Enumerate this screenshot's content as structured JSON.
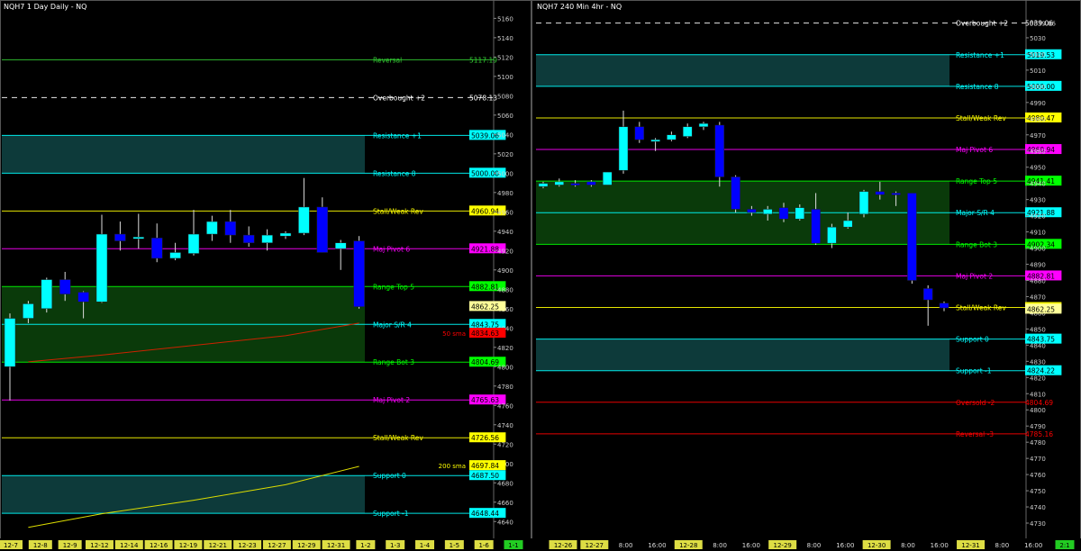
{
  "chart_data": [
    {
      "type": "candlestick",
      "title": "NQH7 1 Day  Daily - NQ",
      "ylim": [
        4630,
        5165
      ],
      "y_ticks": [
        4640,
        4660,
        4680,
        4700,
        4720,
        4740,
        4760,
        4780,
        4800,
        4820,
        4840,
        4860,
        4880,
        4900,
        4920,
        4940,
        4960,
        4980,
        5000,
        5020,
        5040,
        5060,
        5080,
        5100,
        5120,
        5140,
        5160
      ],
      "x_labels": [
        "12-7",
        "12-8",
        "12-9",
        "12-12",
        "12-14",
        "12-16",
        "12-19",
        "12-21",
        "12-23",
        "12-27",
        "12-29",
        "12-31",
        "1-2",
        "1-3",
        "1-4",
        "1-5",
        "1-6",
        "1-1"
      ],
      "candles": [
        {
          "o": 4800,
          "h": 4855,
          "l": 4765,
          "c": 4850,
          "color": "#00ffff"
        },
        {
          "o": 4850,
          "h": 4868,
          "l": 4845,
          "c": 4865,
          "color": "#00ffff"
        },
        {
          "o": 4860,
          "h": 4892,
          "l": 4856,
          "c": 4890,
          "color": "#00ffff"
        },
        {
          "o": 4890,
          "h": 4898,
          "l": 4868,
          "c": 4875,
          "color": "#0000ff"
        },
        {
          "o": 4877,
          "h": 4878,
          "l": 4850,
          "c": 4867,
          "color": "#0000ff"
        },
        {
          "o": 4867,
          "h": 4957,
          "l": 4866,
          "c": 4937,
          "color": "#00ffff"
        },
        {
          "o": 4937,
          "h": 4950,
          "l": 4920,
          "c": 4930,
          "color": "#0000ff"
        },
        {
          "o": 4933,
          "h": 4958,
          "l": 4922,
          "c": 4934,
          "color": "#00ffff"
        },
        {
          "o": 4933,
          "h": 4948,
          "l": 4908,
          "c": 4912,
          "color": "#0000ff"
        },
        {
          "o": 4912,
          "h": 4928,
          "l": 4910,
          "c": 4918,
          "color": "#00ffff"
        },
        {
          "o": 4917,
          "h": 4962,
          "l": 4915,
          "c": 4937,
          "color": "#00ffff"
        },
        {
          "o": 4937,
          "h": 4956,
          "l": 4930,
          "c": 4950,
          "color": "#00ffff"
        },
        {
          "o": 4950,
          "h": 4962,
          "l": 4928,
          "c": 4936,
          "color": "#0000ff"
        },
        {
          "o": 4936,
          "h": 4945,
          "l": 4924,
          "c": 4928,
          "color": "#0000ff"
        },
        {
          "o": 4928,
          "h": 4942,
          "l": 4920,
          "c": 4936,
          "color": "#00ffff"
        },
        {
          "o": 4935,
          "h": 4940,
          "l": 4932,
          "c": 4938,
          "color": "#00ffff"
        },
        {
          "o": 4938,
          "h": 4995,
          "l": 4936,
          "c": 4965,
          "color": "#00ffff"
        },
        {
          "o": 4965,
          "h": 4975,
          "l": 4918,
          "c": 4918,
          "color": "#0000ff"
        },
        {
          "o": 4928,
          "h": 4931,
          "l": 4900,
          "c": 4922,
          "color": "#00ffff"
        },
        {
          "o": 4930,
          "h": 4935,
          "l": 4860,
          "c": 4862,
          "color": "#0000ff"
        }
      ],
      "sma_50": [
        [
          1,
          4805
        ],
        [
          5,
          4812
        ],
        [
          10,
          4822
        ],
        [
          15,
          4832
        ],
        [
          19,
          4845
        ]
      ],
      "sma_200": [
        [
          1,
          4634
        ],
        [
          5,
          4648
        ],
        [
          10,
          4662
        ],
        [
          15,
          4678
        ],
        [
          19,
          4697
        ]
      ],
      "levels": [
        {
          "name": "Reversal",
          "value": 5117.19,
          "label": "5117.19",
          "color": "#33cc33"
        },
        {
          "name": "Overbought +2",
          "value": 5078.13,
          "label": "5078.13",
          "color": "#ffffff"
        },
        {
          "name": "Resistance +1",
          "value": 5039.06,
          "label": "5039.06",
          "color": "#00ffff"
        },
        {
          "name": "Resistance 8",
          "value": 5000,
          "label": "5000.00",
          "color": "#00ffff"
        },
        {
          "name": "Stall/Weak Rev",
          "value": 4960.94,
          "label": "4960.94",
          "color": "#ffff00"
        },
        {
          "name": "Maj Pivot 6",
          "value": 4921.88,
          "label": "4921.88",
          "color": "#ff00ff"
        },
        {
          "name": "Range Top 5",
          "value": 4882.81,
          "label": "4882.81",
          "color": "#00ff00"
        },
        {
          "name": "Major S/R 4",
          "value": 4843.75,
          "label": "4843.75",
          "color": "#00ffff"
        },
        {
          "name": "Range Bot 3",
          "value": 4804.69,
          "label": "4804.69",
          "color": "#00ff00"
        },
        {
          "name": "Maj Pivot 2",
          "value": 4765.63,
          "label": "4765.63",
          "color": "#ff00ff"
        },
        {
          "name": "Stall/Weak Rev",
          "value": 4726.56,
          "label": "4726.56",
          "color": "#ffff00"
        },
        {
          "name": "Support 0",
          "value": 4687.5,
          "label": "4687.50",
          "color": "#00ffff"
        },
        {
          "name": "Support -1",
          "value": 4648.44,
          "label": "4648.44",
          "color": "#00ffff"
        }
      ],
      "zones": [
        {
          "from": 5000,
          "to": 5039.06,
          "color": "#0d3a3a"
        },
        {
          "from": 4804.69,
          "to": 4882.81,
          "color": "#0a3a0a"
        },
        {
          "from": 4648.44,
          "to": 4687.5,
          "color": "#0d3a3a"
        }
      ],
      "price_markers": [
        {
          "label": "4862.25",
          "value": 4862.25,
          "color": "#ffff99"
        },
        {
          "label": "4834.63",
          "value": 4834.63,
          "color": "#ff0000",
          "name": "50 sma"
        },
        {
          "label": "4697.84",
          "value": 4697.84,
          "color": "#ffff00",
          "name": "200 sma"
        }
      ]
    },
    {
      "type": "candlestick",
      "title": "NQH7 240 Min  4hr - NQ",
      "ylim": [
        4725,
        5045
      ],
      "y_ticks": [
        4730,
        4740,
        4750,
        4760,
        4770,
        4780,
        4790,
        4800,
        4810,
        4820,
        4830,
        4840,
        4850,
        4860,
        4870,
        4880,
        4890,
        4900,
        4910,
        4920,
        4930,
        4940,
        4950,
        4960,
        4970,
        4980,
        4990,
        5000,
        5010,
        5020,
        5030,
        5039.06
      ],
      "x_labels": [
        "12-26",
        "12-27",
        "8:00",
        "16:00",
        "12-28",
        "8:00",
        "16:00",
        "12-29",
        "8:00",
        "16:00",
        "12-30",
        "8:00",
        "16:00",
        "12-31",
        "8:00",
        "16:00",
        "2:1"
      ],
      "candles": [
        {
          "o": 4938,
          "h": 4941,
          "l": 4937,
          "c": 4940,
          "color": "#00ffff"
        },
        {
          "o": 4939,
          "h": 4943,
          "l": 4938,
          "c": 4941,
          "color": "#00ffff"
        },
        {
          "o": 4940,
          "h": 4942,
          "l": 4938,
          "c": 4939,
          "color": "#0000ff"
        },
        {
          "o": 4939,
          "h": 4942,
          "l": 4938,
          "c": 4941,
          "color": "#0000ff"
        },
        {
          "o": 4939,
          "h": 4947,
          "l": 4939,
          "c": 4947,
          "color": "#00ffff"
        },
        {
          "o": 4948,
          "h": 4985,
          "l": 4946,
          "c": 4975,
          "color": "#00ffff"
        },
        {
          "o": 4975,
          "h": 4978,
          "l": 4965,
          "c": 4967,
          "color": "#0000ff"
        },
        {
          "o": 4966,
          "h": 4968,
          "l": 4960,
          "c": 4967,
          "color": "#00ffff"
        },
        {
          "o": 4967,
          "h": 4972,
          "l": 4966,
          "c": 4970,
          "color": "#00ffff"
        },
        {
          "o": 4969,
          "h": 4977,
          "l": 4968,
          "c": 4975,
          "color": "#00ffff"
        },
        {
          "o": 4975,
          "h": 4978,
          "l": 4973,
          "c": 4977,
          "color": "#00ffff"
        },
        {
          "o": 4976,
          "h": 4978,
          "l": 4938,
          "c": 4944,
          "color": "#0000ff"
        },
        {
          "o": 4944,
          "h": 4945,
          "l": 4922,
          "c": 4924,
          "color": "#0000ff"
        },
        {
          "o": 4924,
          "h": 4926,
          "l": 4920,
          "c": 4922,
          "color": "#0000ff"
        },
        {
          "o": 4921,
          "h": 4926,
          "l": 4917,
          "c": 4924,
          "color": "#00ffff"
        },
        {
          "o": 4925,
          "h": 4928,
          "l": 4916,
          "c": 4918,
          "color": "#0000ff"
        },
        {
          "o": 4918,
          "h": 4927,
          "l": 4917,
          "c": 4925,
          "color": "#00ffff"
        },
        {
          "o": 4924,
          "h": 4934,
          "l": 4902,
          "c": 4903,
          "color": "#0000ff"
        },
        {
          "o": 4903,
          "h": 4915,
          "l": 4900,
          "c": 4913,
          "color": "#00ffff"
        },
        {
          "o": 4913,
          "h": 4922,
          "l": 4912,
          "c": 4917,
          "color": "#00ffff"
        },
        {
          "o": 4921,
          "h": 4936,
          "l": 4919,
          "c": 4935,
          "color": "#00ffff"
        },
        {
          "o": 4935,
          "h": 4941,
          "l": 4930,
          "c": 4933,
          "color": "#0000ff"
        },
        {
          "o": 4934,
          "h": 4935,
          "l": 4926,
          "c": 4933,
          "color": "#0000ff"
        },
        {
          "o": 4934,
          "h": 4934,
          "l": 4878,
          "c": 4880,
          "color": "#0000ff"
        },
        {
          "o": 4875,
          "h": 4877,
          "l": 4852,
          "c": 4868,
          "color": "#0000ff"
        },
        {
          "o": 4866,
          "h": 4867,
          "l": 4861,
          "c": 4863,
          "color": "#0000ff"
        }
      ],
      "levels": [
        {
          "name": "Overbought +2",
          "value": 5039.06,
          "label": "5039.06",
          "color": "#ffffff"
        },
        {
          "name": "Resistance +1",
          "value": 5019.53,
          "label": "5019.53",
          "color": "#00ffff"
        },
        {
          "name": "Resistance 8",
          "value": 5000,
          "label": "5000.00",
          "color": "#00ffff"
        },
        {
          "name": "Stall/Weak Rev",
          "value": 4980.47,
          "label": "4980.47",
          "color": "#ffff00"
        },
        {
          "name": "Maj Pivot 6",
          "value": 4960.94,
          "label": "4960.94",
          "color": "#ff00ff"
        },
        {
          "name": "Range Top 5",
          "value": 4941.41,
          "label": "4941.41",
          "color": "#00ff00"
        },
        {
          "name": "Major S/R 4",
          "value": 4921.88,
          "label": "4921.88",
          "color": "#00ffff"
        },
        {
          "name": "Range Bot 3",
          "value": 4902.34,
          "label": "4902.34",
          "color": "#00ff00"
        },
        {
          "name": "Maj Pivot 2",
          "value": 4882.81,
          "label": "4882.81",
          "color": "#ff00ff"
        },
        {
          "name": "Stall/Weak Rev",
          "value": 4863.28,
          "label": "4863.28",
          "color": "#ffff00"
        },
        {
          "name": "Support 0",
          "value": 4843.75,
          "label": "4843.75",
          "color": "#00ffff"
        },
        {
          "name": "Support -1",
          "value": 4824.22,
          "label": "4824.22",
          "color": "#00ffff"
        },
        {
          "name": "Oversold -2",
          "value": 4804.69,
          "label": "4804.69",
          "color": "#ff0000"
        },
        {
          "name": "Reversal -3",
          "value": 4785.16,
          "label": "4785.16",
          "color": "#ff0000"
        }
      ],
      "zones": [
        {
          "from": 5000,
          "to": 5019.53,
          "color": "#0d3a3a"
        },
        {
          "from": 4902.34,
          "to": 4941.41,
          "color": "#0a3a0a"
        },
        {
          "from": 4824.22,
          "to": 4843.75,
          "color": "#0d3a3a"
        }
      ],
      "price_markers": [
        {
          "label": "4862.25",
          "value": 4862.25,
          "color": "#ffff99"
        }
      ]
    }
  ]
}
